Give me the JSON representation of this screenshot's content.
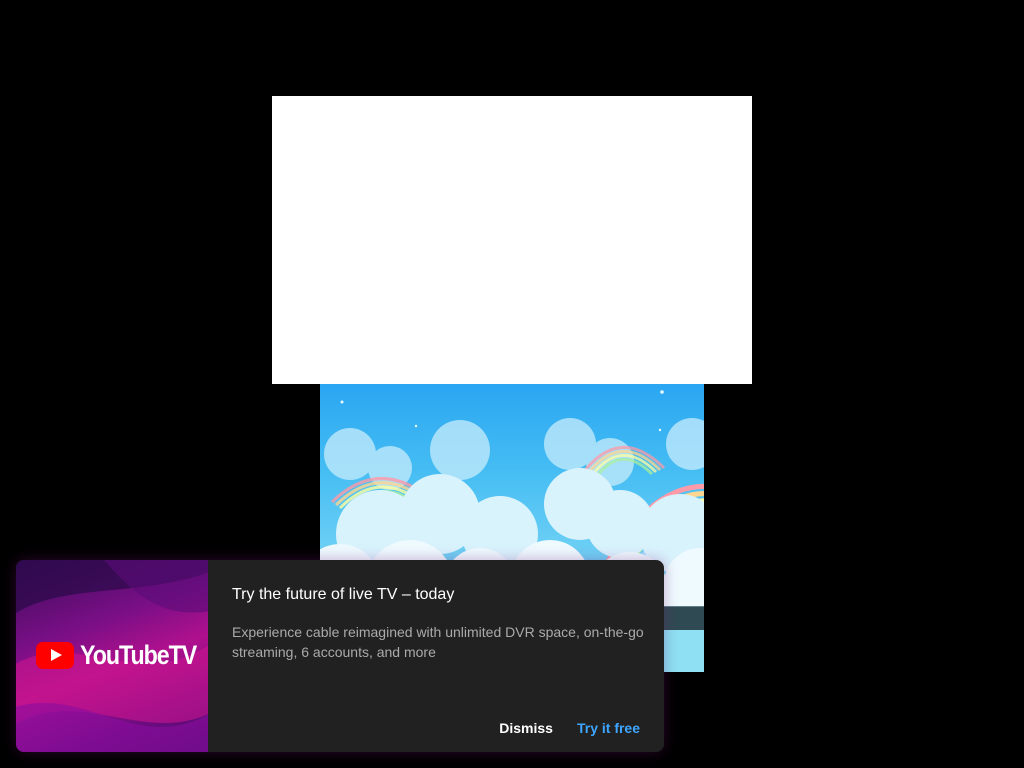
{
  "promo": {
    "logo_text": "YouTubeTV",
    "title": "Try the future of live TV – today",
    "description": "Experience cable reimagined with unlimited DVR space, on-the-go streaming, 6 accounts, and more",
    "dismiss_label": "Dismiss",
    "try_label": "Try it free"
  },
  "colors": {
    "page_background": "#000000",
    "card_background": "#212121",
    "accent_blue": "#3ea6ff",
    "youtube_red": "#ff0000"
  }
}
